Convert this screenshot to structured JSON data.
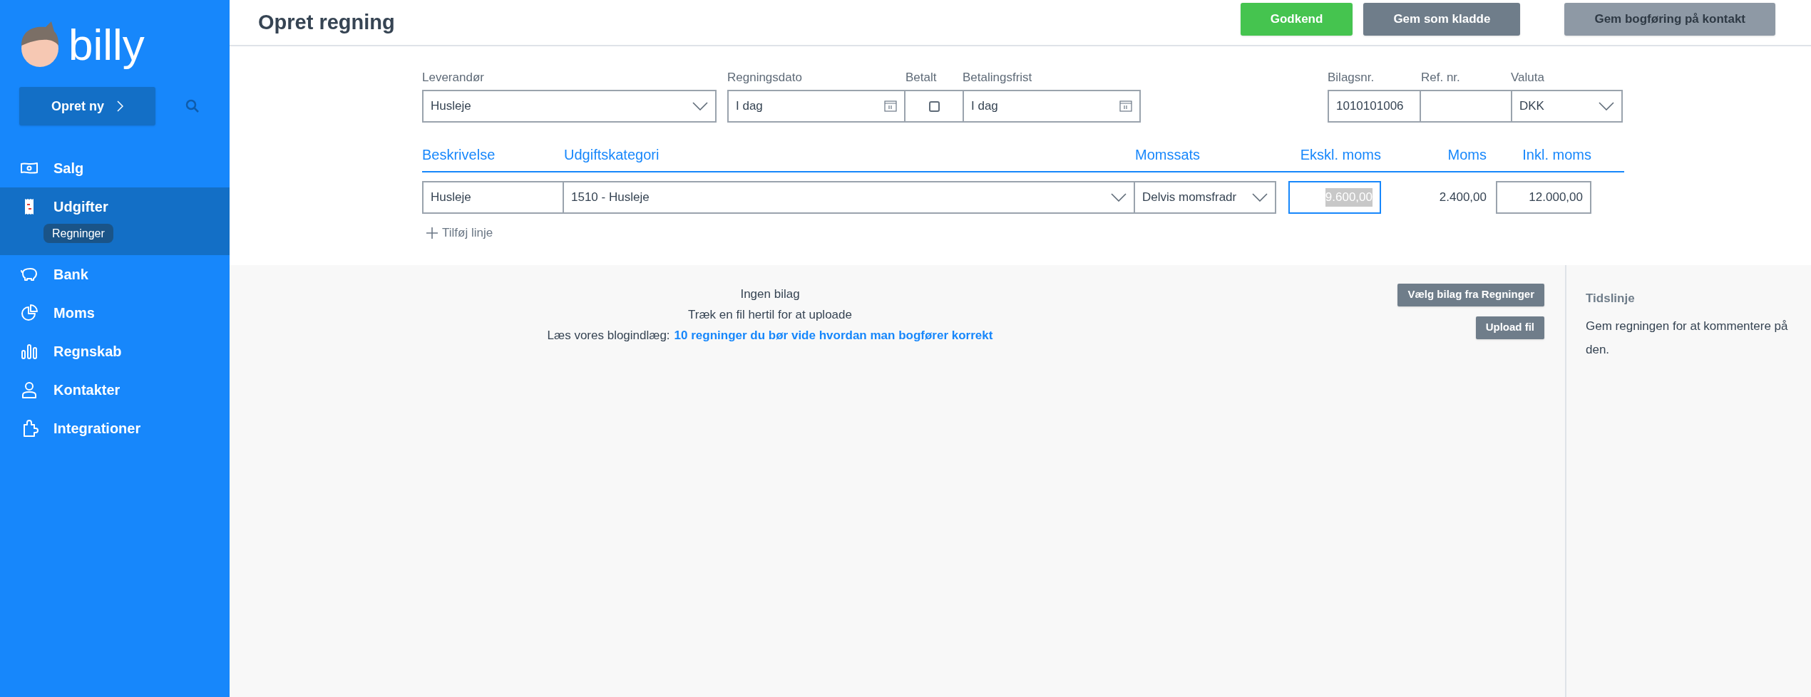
{
  "sidebar": {
    "logo": "billy",
    "create_button": "Opret ny",
    "items": [
      {
        "label": "Salg",
        "selected": false
      },
      {
        "label": "Udgifter",
        "selected": true,
        "children": [
          {
            "label": "Regninger",
            "selected": true
          }
        ]
      },
      {
        "label": "Bank",
        "selected": false
      },
      {
        "label": "Moms",
        "selected": false
      },
      {
        "label": "Regnskab",
        "selected": false
      },
      {
        "label": "Kontakter",
        "selected": false
      },
      {
        "label": "Integrationer",
        "selected": false
      }
    ]
  },
  "header": {
    "title": "Opret regning",
    "buttons": [
      {
        "label": "Godkend",
        "kind": "primary",
        "disabled": false
      },
      {
        "label": "Gem som kladde",
        "kind": "secondary",
        "disabled": false
      },
      {
        "label": "Gem bogføring på kontakt",
        "kind": "secondary",
        "disabled": true
      }
    ]
  },
  "form": {
    "supplier": {
      "label": "Leverandør",
      "value": "Husleje"
    },
    "bill_date": {
      "label": "Regningsdato",
      "value": "I dag"
    },
    "paid": {
      "label": "Betalt",
      "checked": false
    },
    "due_date": {
      "label": "Betalingsfrist",
      "value": "I dag"
    },
    "voucher_no": {
      "label": "Bilagsnr.",
      "value": "1010101006"
    },
    "ref_no": {
      "label": "Ref. nr."
    },
    "currency": {
      "label": "Valuta",
      "value": "DKK"
    }
  },
  "lines": {
    "columns": [
      "Beskrivelse",
      "Udgiftskategori",
      "Momssats",
      "Ekskl. moms",
      "Moms",
      "Inkl. moms"
    ],
    "rows": [
      {
        "description": "Husleje",
        "category": "1510 - Husleje",
        "vat_rate": "Delvis momsfradr",
        "excl": "9.600,00",
        "excl_focused": true,
        "vat": "2.400,00",
        "incl": "12.000,00"
      }
    ],
    "add_line": "Tilføj linje"
  },
  "attachments": {
    "title": "Ingen bilag",
    "hint": "Træk en fil hertil for at uploade",
    "blog_prefix": "Læs vores blogindlæg:",
    "blog_link": "10 regninger du bør vide hvordan man bogfører korrekt",
    "buttons": [
      "Vælg bilag fra Regninger",
      "Upload fil"
    ]
  },
  "timeline": {
    "title": "Tidslinje",
    "text": "Gem regningen for at kommentere på den."
  }
}
